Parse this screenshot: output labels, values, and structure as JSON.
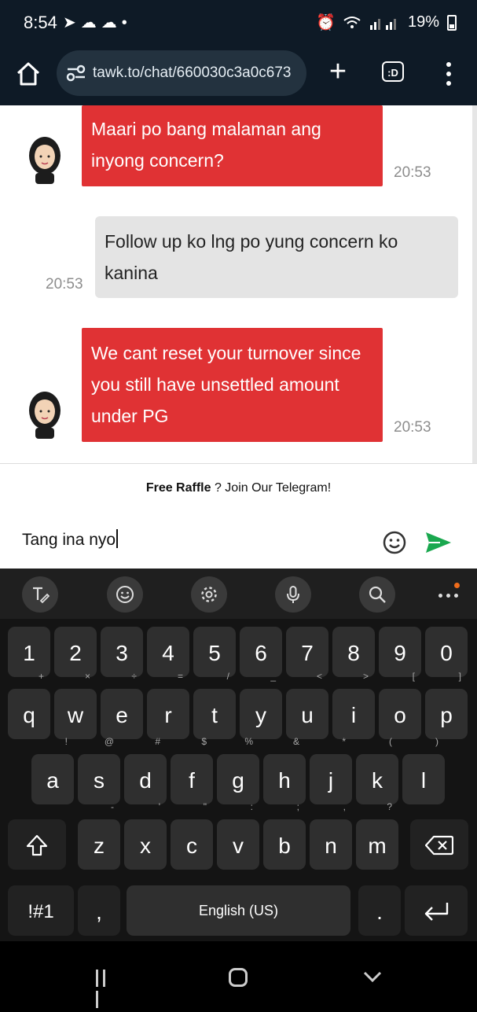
{
  "status_bar": {
    "time": "8:54",
    "left_icons": "➤☁☁•",
    "battery": "19%"
  },
  "browser": {
    "url": "tawk.to/chat/660030c3a0c673",
    "plus": "+",
    "tabs_label": ":D"
  },
  "chat": {
    "messages": [
      {
        "sender": "agent",
        "text": "Maari po bang malaman ang inyong concern?",
        "time": "20:53"
      },
      {
        "sender": "user",
        "text": "Follow up ko lng po yung concern ko kanina",
        "time": "20:53"
      },
      {
        "sender": "agent",
        "text": "We cant reset your turnover since you still have unsettled amount under PG",
        "time": "20:53"
      }
    ]
  },
  "promo": {
    "bold": "Free Raffle",
    "rest": " ? Join Our Telegram!"
  },
  "composer": {
    "value": "Tang ina nyo"
  },
  "keyboard": {
    "number_row": [
      "1",
      "2",
      "3",
      "4",
      "5",
      "6",
      "7",
      "8",
      "9",
      "0"
    ],
    "row1": [
      {
        "k": "q",
        "s": "+"
      },
      {
        "k": "w",
        "s": "×"
      },
      {
        "k": "e",
        "s": "÷"
      },
      {
        "k": "r",
        "s": "="
      },
      {
        "k": "t",
        "s": "/"
      },
      {
        "k": "y",
        "s": "_"
      },
      {
        "k": "u",
        "s": "<"
      },
      {
        "k": "i",
        "s": ">"
      },
      {
        "k": "o",
        "s": "["
      },
      {
        "k": "p",
        "s": "]"
      }
    ],
    "row2": [
      {
        "k": "a",
        "s": "!"
      },
      {
        "k": "s",
        "s": "@"
      },
      {
        "k": "d",
        "s": "#"
      },
      {
        "k": "f",
        "s": "$"
      },
      {
        "k": "g",
        "s": "%"
      },
      {
        "k": "h",
        "s": "&"
      },
      {
        "k": "j",
        "s": "*"
      },
      {
        "k": "k",
        "s": "("
      },
      {
        "k": "l",
        "s": ")"
      }
    ],
    "row3": [
      {
        "k": "z",
        "s": "-"
      },
      {
        "k": "x",
        "s": "'"
      },
      {
        "k": "c",
        "s": "\""
      },
      {
        "k": "v",
        "s": ":"
      },
      {
        "k": "b",
        "s": ";"
      },
      {
        "k": "n",
        "s": ","
      },
      {
        "k": "m",
        "s": "?"
      }
    ],
    "symbols_key": "!#1",
    "comma_key": ",",
    "space_label": "English (US)",
    "period_key": "."
  }
}
